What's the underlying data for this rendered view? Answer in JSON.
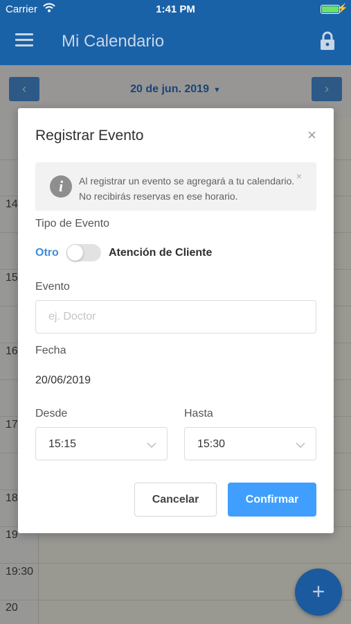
{
  "status_bar": {
    "carrier": "Carrier",
    "time": "1:41 PM",
    "battery_icon": "battery-icon",
    "wifi_icon": "wifi-icon"
  },
  "header": {
    "title": "Mi Calendario",
    "menu_icon": "menu-icon",
    "lock_icon": "lock-icon"
  },
  "calendar_nav": {
    "prev_symbol": "‹",
    "next_symbol": "›",
    "date": "20 de jun. 2019",
    "caret": "▼"
  },
  "calendar": {
    "hours": [
      "14",
      "15",
      "16",
      "17",
      "18",
      "19",
      "19:30",
      "20"
    ]
  },
  "modal": {
    "title": "Registrar Evento",
    "close_symbol": "×",
    "info": {
      "icon_glyph": "i",
      "text": "Al registrar un evento se agregará a tu calendario. No recibirás reservas en ese horario.",
      "close_symbol": "×"
    },
    "event_type_label": "Tipo de Evento",
    "toggle_left": "Otro",
    "toggle_right": "Atención de Cliente",
    "toggle_on": false,
    "event_label": "Evento",
    "event_placeholder": "ej. Doctor",
    "event_value": "",
    "date_label": "Fecha",
    "date_value": "20/06/2019",
    "from_label": "Desde",
    "from_value": "15:15",
    "to_label": "Hasta",
    "to_value": "15:30",
    "cancel_label": "Cancelar",
    "confirm_label": "Confirmar"
  },
  "fab": {
    "symbol": "+"
  },
  "colors": {
    "header_bg": "#1a62a8",
    "accent": "#409eff",
    "toggle_left_text": "#3c8dde"
  }
}
